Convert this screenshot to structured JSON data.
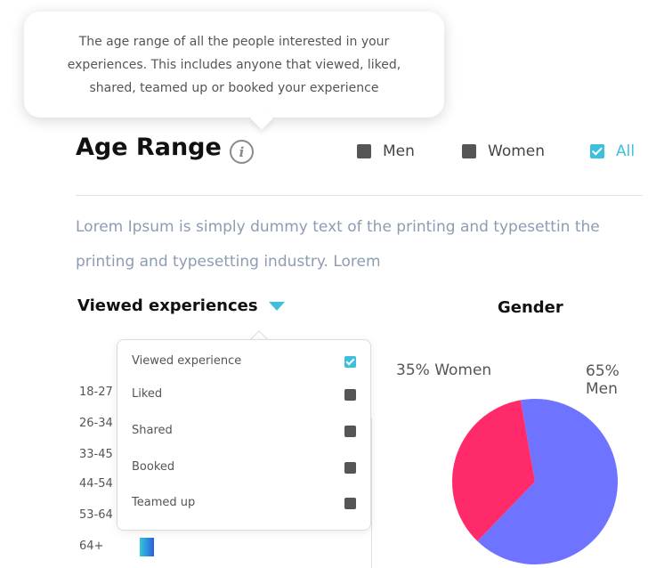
{
  "tooltip": {
    "text": "The age range of all the people interested in your experiences. This includes anyone that viewed, liked, shared, teamed up or booked your experience"
  },
  "header": {
    "title": "Age Range",
    "info_icon": "info-icon",
    "filters": [
      {
        "label": "Men",
        "checked": false
      },
      {
        "label": "Women",
        "checked": false
      },
      {
        "label": "All",
        "checked": true
      }
    ]
  },
  "description": "Lorem Ipsum is simply dummy text of the printing and typesettin the printing and typesetting industry. Lorem",
  "dropdown": {
    "selected": "Viewed experiences",
    "items": [
      {
        "label": "Viewed experience",
        "checked": true
      },
      {
        "label": "Liked",
        "checked": false
      },
      {
        "label": "Shared",
        "checked": false
      },
      {
        "label": "Booked",
        "checked": false
      },
      {
        "label": "Teamed up",
        "checked": false
      }
    ]
  },
  "age_ranges": [
    "18-27",
    "26-34",
    "33-45",
    "44-54",
    "53-64",
    "64+"
  ],
  "gender": {
    "title": "Gender",
    "women_label": "35% Women",
    "men_label": "65% Men"
  },
  "chart_data": {
    "type": "pie",
    "title": "Gender",
    "slices": [
      {
        "label": "Women",
        "value": 35,
        "color": "#ff2a6a"
      },
      {
        "label": "Men",
        "value": 65,
        "color": "#6e74ff"
      }
    ]
  },
  "colors": {
    "accent": "#3cc0dd",
    "women": "#ff2a6a",
    "men": "#6e74ff"
  }
}
